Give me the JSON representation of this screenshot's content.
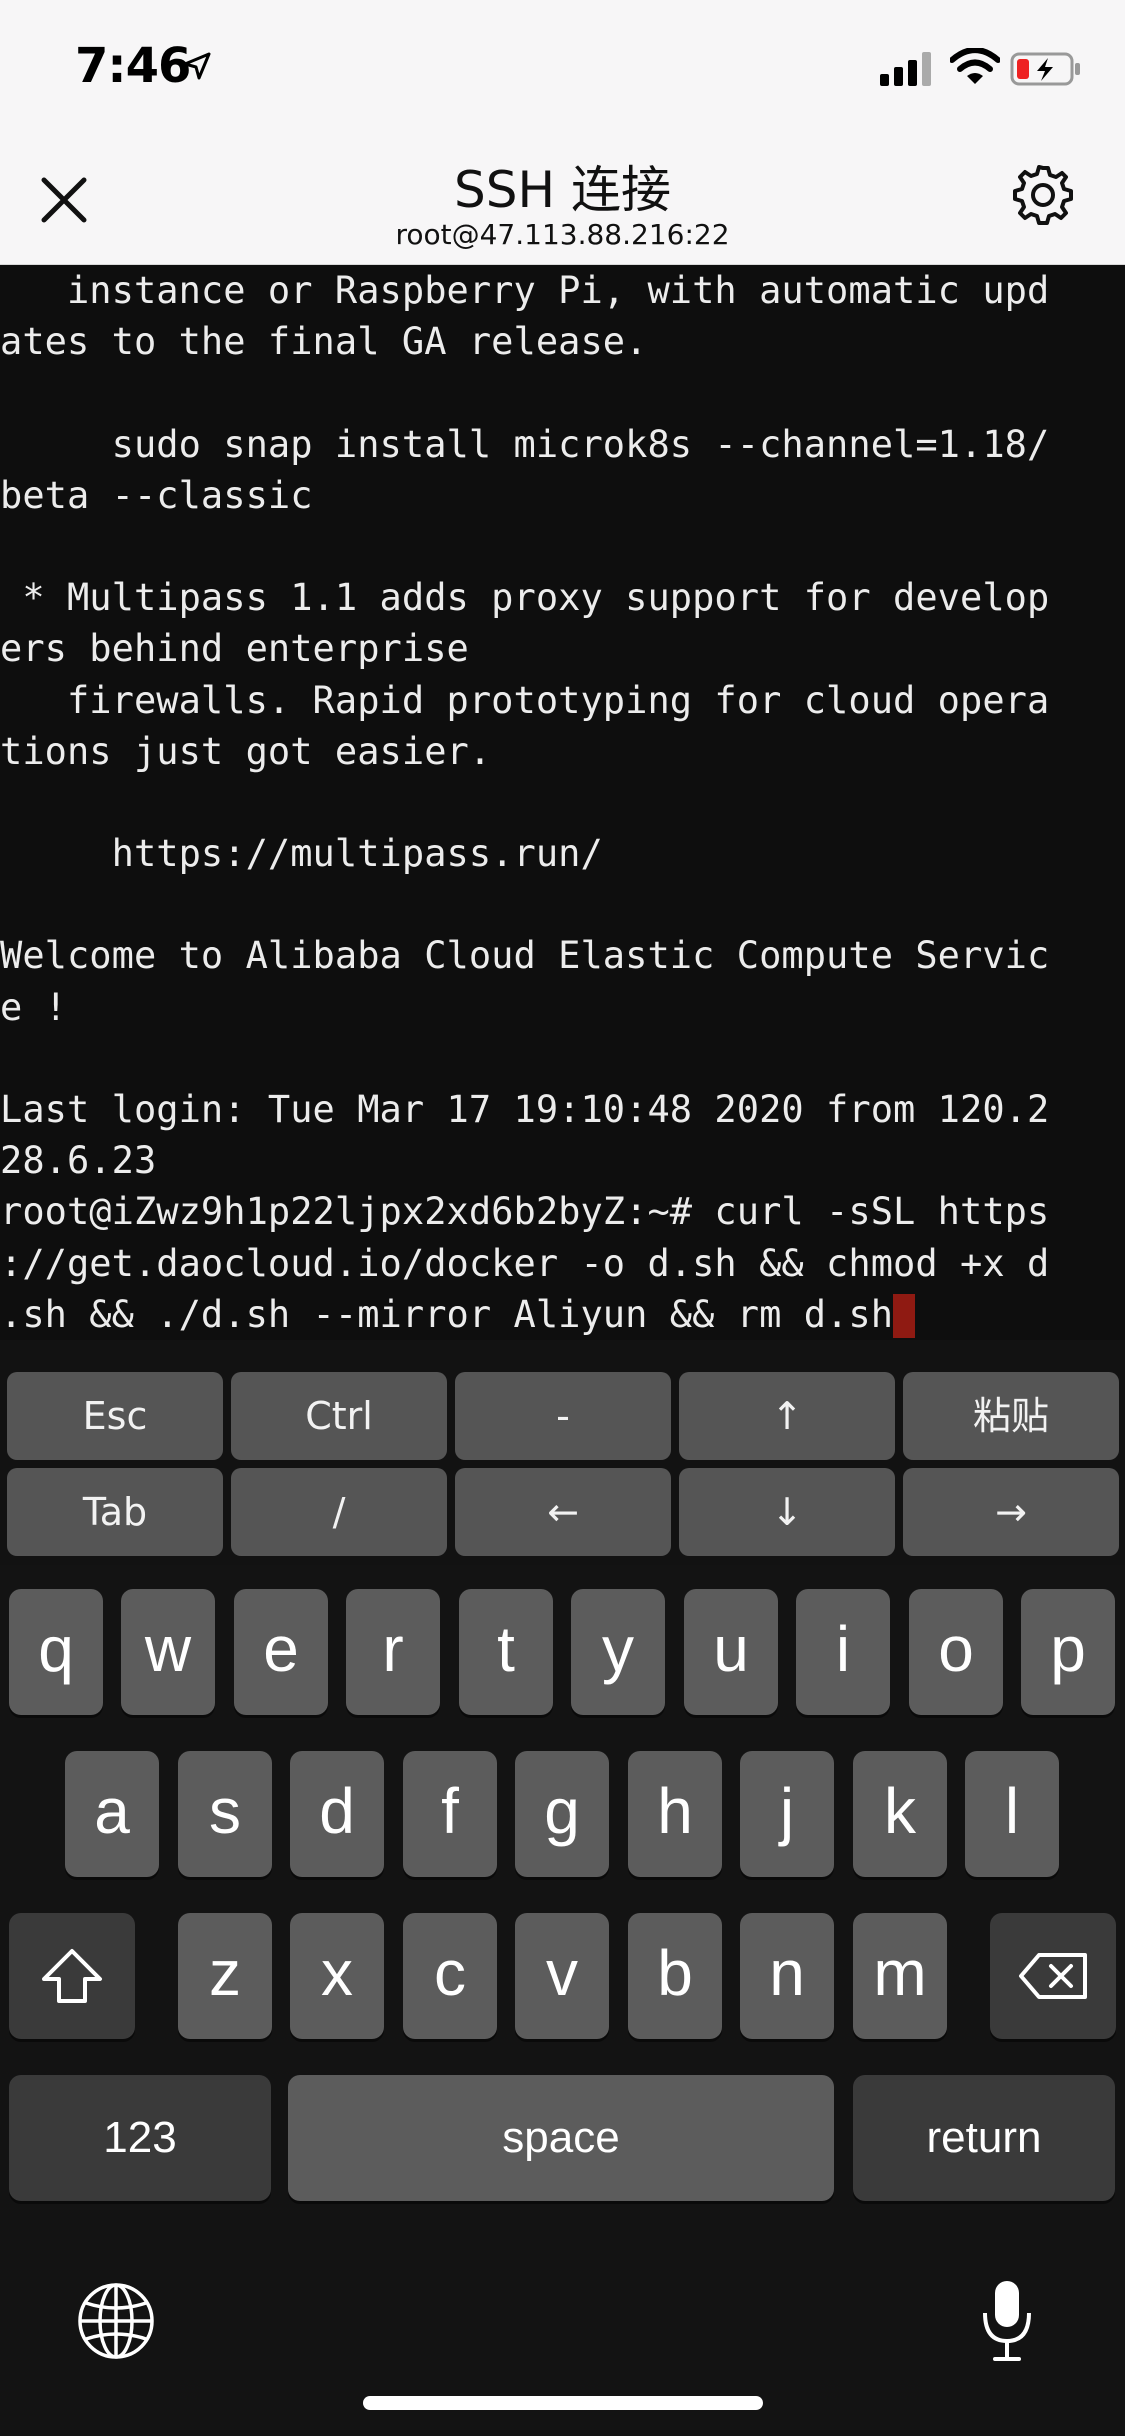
{
  "status_bar": {
    "time": "7:46"
  },
  "header": {
    "title": "SSH 连接",
    "subtitle": "root@47.113.88.216:22"
  },
  "terminal": {
    "lines": [
      "   instance or Raspberry Pi, with automatic upd",
      "ates to the final GA release.",
      "",
      "     sudo snap install microk8s --channel=1.18/",
      "beta --classic",
      "",
      " * Multipass 1.1 adds proxy support for develop",
      "ers behind enterprise",
      "   firewalls. Rapid prototyping for cloud opera",
      "tions just got easier.",
      "",
      "     https://multipass.run/",
      "",
      "Welcome to Alibaba Cloud Elastic Compute Servic",
      "e !",
      "",
      "Last login: Tue Mar 17 19:10:48 2020 from 120.2",
      "28.6.23",
      "root@iZwz9h1p22ljpx2xd6b2byZ:~# curl -sSL https",
      "://get.daocloud.io/docker -o d.sh && chmod +x d",
      ".sh && ./d.sh --mirror Aliyun && rm d.sh"
    ],
    "cursor_color": "#8f1a12"
  },
  "extra_keys": {
    "row1": [
      "Esc",
      "Ctrl",
      "-",
      "↑",
      "粘贴"
    ],
    "row2": [
      "Tab",
      "/",
      "←",
      "↓",
      "→"
    ]
  },
  "keyboard": {
    "row1": [
      "q",
      "w",
      "e",
      "r",
      "t",
      "y",
      "u",
      "i",
      "o",
      "p"
    ],
    "row2": [
      "a",
      "s",
      "d",
      "f",
      "g",
      "h",
      "j",
      "k",
      "l"
    ],
    "row3": [
      "z",
      "x",
      "c",
      "v",
      "b",
      "n",
      "m"
    ],
    "numbers_label": "123",
    "space_label": "space",
    "return_label": "return"
  }
}
